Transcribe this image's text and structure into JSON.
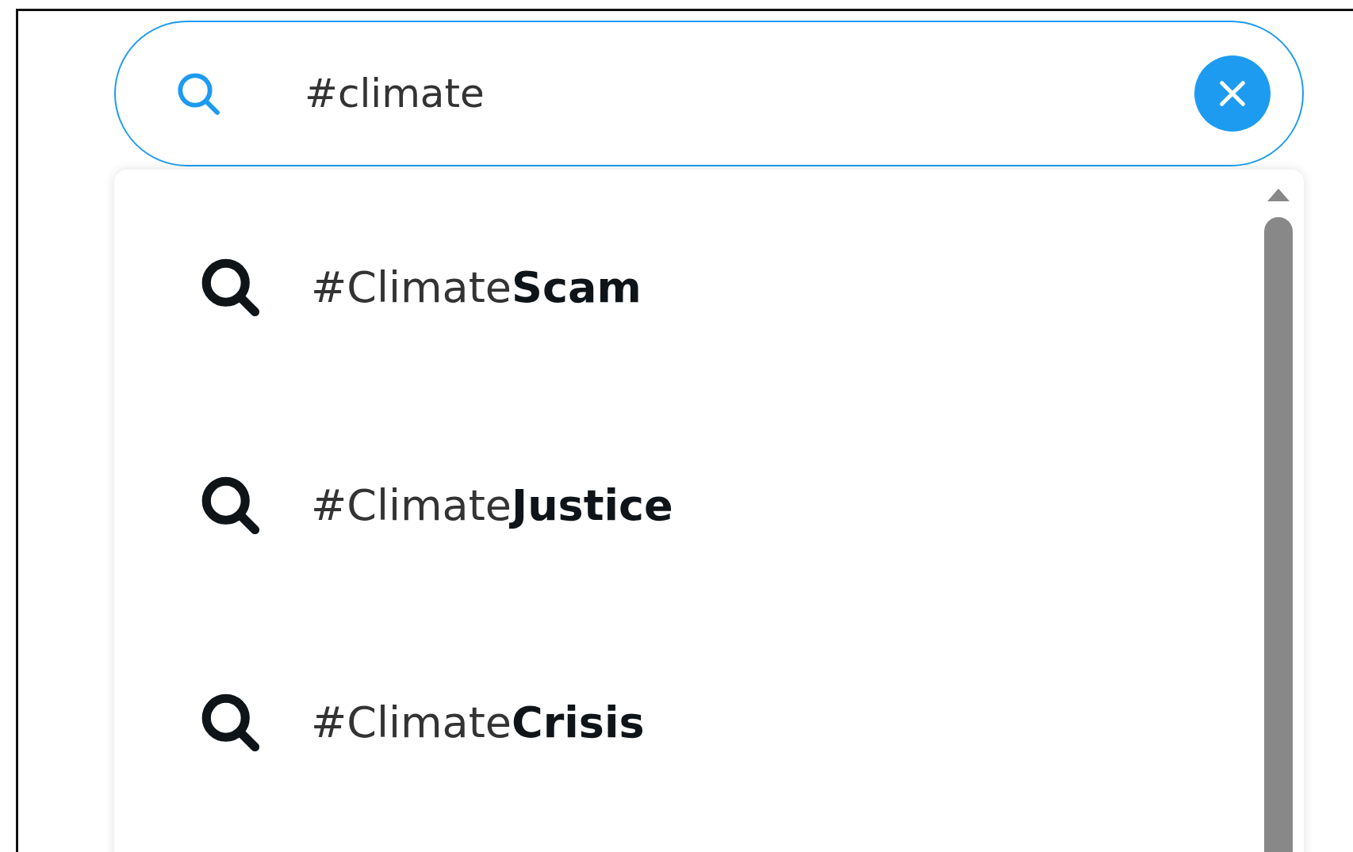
{
  "search": {
    "value": "#climate"
  },
  "suggestions": [
    {
      "text": "#Climate**Scam**"
    },
    {
      "text": "#Climate**Justice**"
    },
    {
      "text": "#Climate**Crisis**"
    }
  ]
}
